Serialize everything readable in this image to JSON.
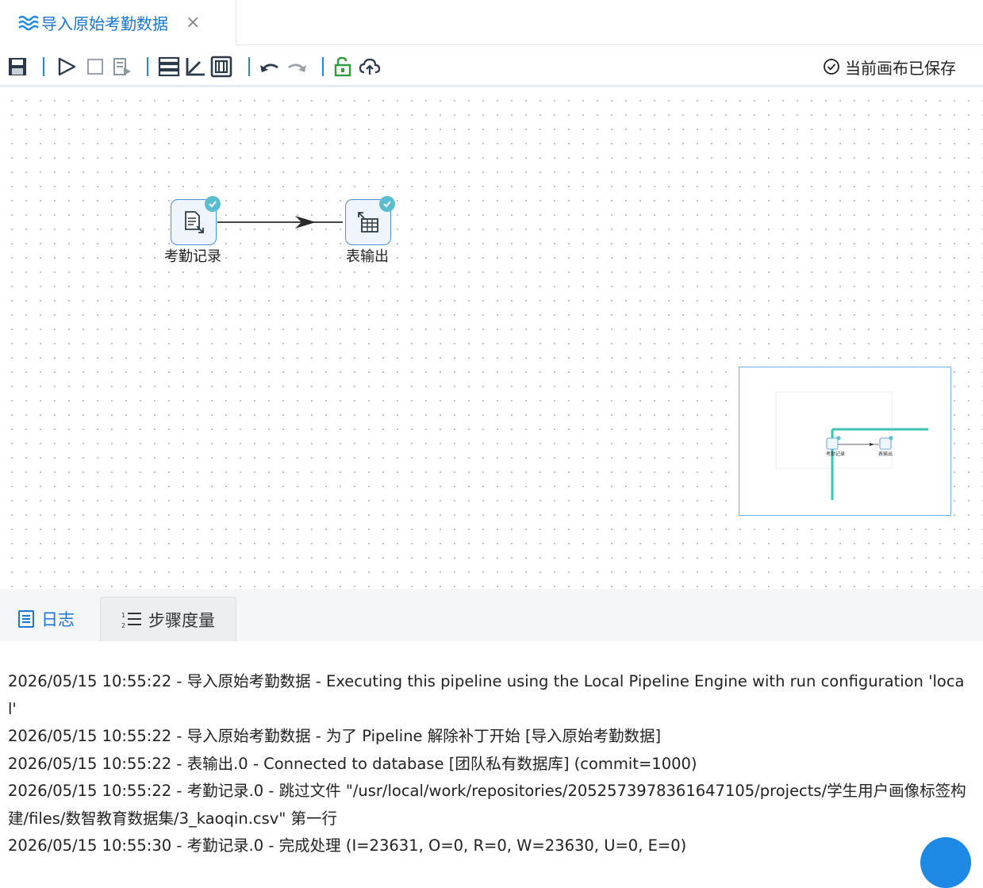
{
  "tab": {
    "title": "导入原始考勤数据",
    "close_glyph": "×",
    "icon": "waves-icon"
  },
  "toolbar": {
    "buttons": [
      "save-icon",
      "run-icon",
      "stop-icon",
      "preview-icon",
      "layout-icon",
      "align-icon",
      "metrics-icon",
      "undo-icon",
      "redo-icon",
      "unlock-icon",
      "upload-icon"
    ],
    "status_text": "当前画布已保存",
    "accent": "#1e88e5"
  },
  "canvas": {
    "nodes": [
      {
        "label": "考勤记录",
        "icon": "file-input-icon",
        "status": "check-icon"
      },
      {
        "label": "表输出",
        "icon": "table-output-icon",
        "status": "check-icon"
      }
    ],
    "minimap": {
      "node_labels": [
        "考勤记录",
        "表输出"
      ]
    }
  },
  "bottom_tabs": [
    {
      "label": "日志",
      "icon": "log-icon",
      "active": true
    },
    {
      "label": "步骤度量",
      "icon": "ordered-list-icon",
      "active": false
    }
  ],
  "log_lines": [
    "2026/05/15 10:55:22 - 导入原始考勤数据 - Executing this pipeline using the Local Pipeline Engine with run configuration 'local'",
    "2026/05/15 10:55:22 - 导入原始考勤数据 - 为了 Pipeline 解除补丁开始 [导入原始考勤数据]",
    "2026/05/15 10:55:22 - 表输出.0 - Connected to database [团队私有数据库] (commit=1000)",
    "2026/05/15 10:55:22 - 考勤记录.0 - 跳过文件 \"/usr/local/work/repositories/2052573978361647105/projects/学生用户画像标签构建/files/数智教育数据集/3_kaoqin.csv\" 第一行",
    "2026/05/15 10:55:30 - 考勤记录.0 - 完成处理 (I=23631, O=0, R=0, W=23630, U=0, E=0)"
  ]
}
